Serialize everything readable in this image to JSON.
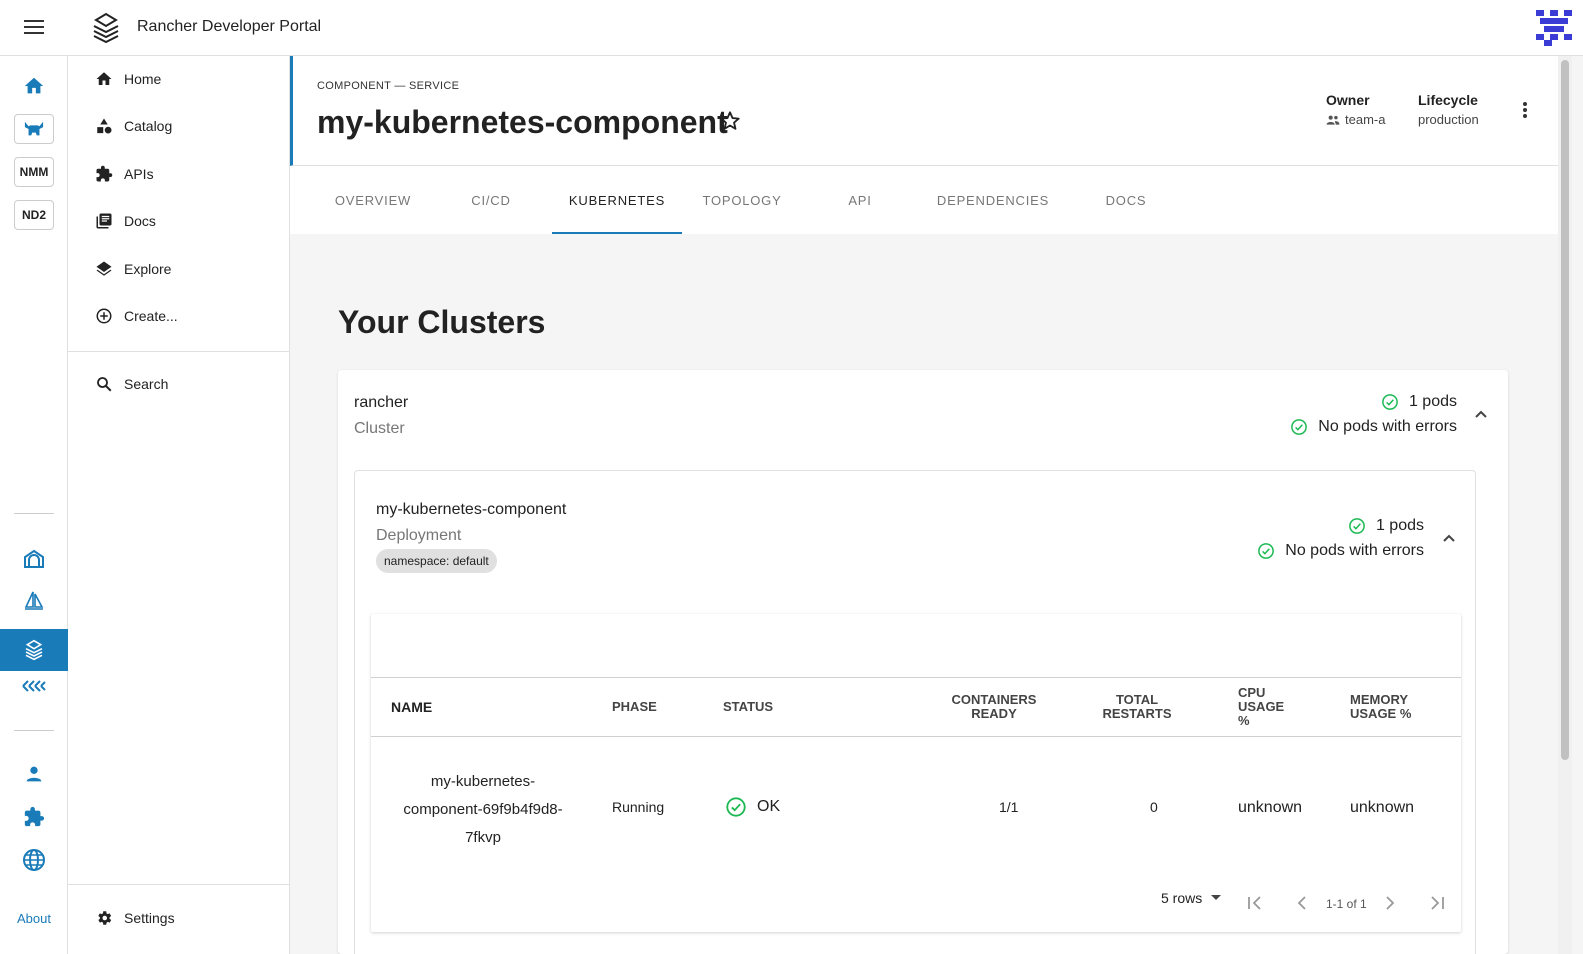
{
  "app": {
    "title": "Rancher Developer Portal"
  },
  "rail": {
    "boxes": [
      "NMM",
      "ND2"
    ],
    "about_label": "About"
  },
  "nav": {
    "items": [
      {
        "label": "Home",
        "icon": "home-icon"
      },
      {
        "label": "Catalog",
        "icon": "catalog-icon"
      },
      {
        "label": "APIs",
        "icon": "puzzle-icon"
      },
      {
        "label": "Docs",
        "icon": "docs-icon"
      },
      {
        "label": "Explore",
        "icon": "layers-icon"
      },
      {
        "label": "Create...",
        "icon": "add-circle-icon"
      }
    ],
    "search_label": "Search",
    "settings_label": "Settings"
  },
  "header": {
    "kind": "COMPONENT — SERVICE",
    "title": "my-kubernetes-component",
    "owner_label": "Owner",
    "owner_value": "team-a",
    "lifecycle_label": "Lifecycle",
    "lifecycle_value": "production"
  },
  "tabs": [
    "OVERVIEW",
    "CI/CD",
    "KUBERNETES",
    "TOPOLOGY",
    "API",
    "DEPENDENCIES",
    "DOCS"
  ],
  "active_tab": "KUBERNETES",
  "content": {
    "section_title": "Your Clusters",
    "cluster": {
      "name": "rancher",
      "subtitle": "Cluster",
      "pods": "1 pods",
      "errors": "No pods with errors"
    },
    "deployment": {
      "name": "my-kubernetes-component",
      "subtitle": "Deployment",
      "namespace_chip": "namespace: default",
      "pods": "1 pods",
      "errors": "No pods with errors"
    },
    "table": {
      "headers": {
        "name": "NAME",
        "phase": "PHASE",
        "status": "STATUS",
        "containers_ready": [
          "CONTAINERS",
          "READY"
        ],
        "total_restarts": [
          "TOTAL",
          "RESTARTS"
        ],
        "cpu_usage": [
          "CPU",
          "USAGE",
          "%"
        ],
        "memory_usage": [
          "MEMORY",
          "USAGE %"
        ]
      },
      "rows": [
        {
          "name_lines": [
            "my-kubernetes-",
            "component-69f9b4f9d8-",
            "7fkvp"
          ],
          "phase": "Running",
          "status": "OK",
          "containers_ready": "1/1",
          "total_restarts": "0",
          "cpu_usage": "unknown",
          "memory_usage": "unknown"
        }
      ],
      "pagination": {
        "rows_per_page": "5 rows",
        "range": "1-1 of 1"
      }
    }
  },
  "colors": {
    "accent": "#1a7bb9",
    "ok": "#1db954"
  }
}
